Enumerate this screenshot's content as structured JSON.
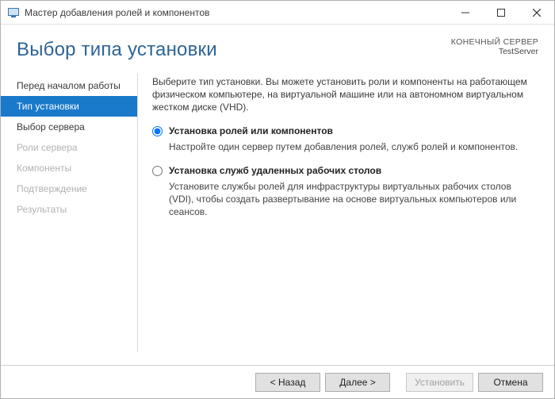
{
  "window": {
    "title": "Мастер добавления ролей и компонентов"
  },
  "header": {
    "page_title": "Выбор типа установки",
    "destination_label": "КОНЕЧНЫЙ СЕРВЕР",
    "destination_value": "TestServer"
  },
  "sidebar": {
    "items": [
      {
        "label": "Перед началом работы",
        "state": "done"
      },
      {
        "label": "Тип установки",
        "state": "active"
      },
      {
        "label": "Выбор сервера",
        "state": "pending"
      },
      {
        "label": "Роли сервера",
        "state": "disabled"
      },
      {
        "label": "Компоненты",
        "state": "disabled"
      },
      {
        "label": "Подтверждение",
        "state": "disabled"
      },
      {
        "label": "Результаты",
        "state": "disabled"
      }
    ]
  },
  "content": {
    "intro": "Выберите тип установки. Вы можете установить роли и компоненты на работающем физическом компьютере, на виртуальной машине или на автономном виртуальном жестком диске (VHD).",
    "options": [
      {
        "title": "Установка ролей или компонентов",
        "desc": "Настройте один сервер путем добавления ролей, служб ролей и компонентов.",
        "selected": true
      },
      {
        "title": "Установка служб удаленных рабочих столов",
        "desc": "Установите службы ролей для инфраструктуры виртуальных рабочих столов (VDI), чтобы создать развертывание на основе виртуальных компьютеров или сеансов.",
        "selected": false
      }
    ]
  },
  "footer": {
    "back": "< Назад",
    "next": "Далее >",
    "install": "Установить",
    "cancel": "Отмена"
  }
}
